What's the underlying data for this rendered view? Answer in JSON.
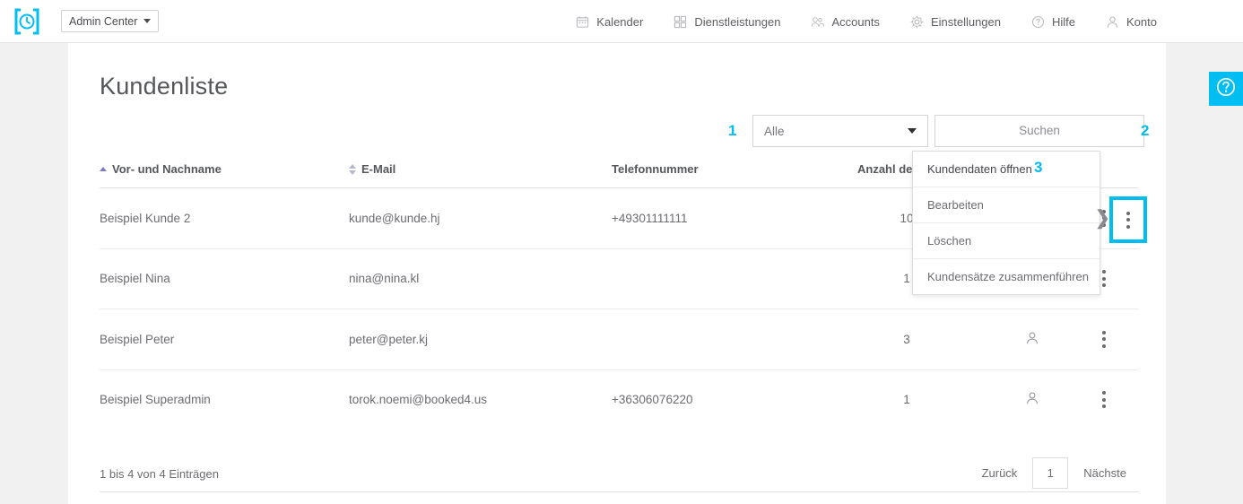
{
  "topbar": {
    "logo_icon": "clock-bracket-logo",
    "brand": {
      "label": "Admin Center",
      "caret_icon": "chevron-down-icon"
    },
    "nav": [
      {
        "label": "Kalender",
        "icon": "calendar-icon"
      },
      {
        "label": "Dienstleistungen",
        "icon": "grid-squares-icon"
      },
      {
        "label": "Accounts",
        "icon": "people-icon"
      },
      {
        "label": "Einstellungen",
        "icon": "gear-icon"
      },
      {
        "label": "Hilfe",
        "icon": "question-circle-icon"
      },
      {
        "label": "Konto",
        "icon": "person-icon"
      }
    ]
  },
  "page": {
    "title": "Kundenliste"
  },
  "filters": {
    "select_value": "Alle",
    "select_caret_icon": "caret-down-icon",
    "search_placeholder": "Suchen",
    "annotation_1": "1",
    "annotation_2": "2"
  },
  "table": {
    "headers": [
      {
        "label": "Vor- und Nachname",
        "sort": "asc",
        "sort_icon": "sort-ascending-icon"
      },
      {
        "label": "E-Mail",
        "sort": "none",
        "sort_icon": "sort-both-icon"
      },
      {
        "label": "Telefonnummer",
        "sort": "none",
        "sort_icon": ""
      },
      {
        "label": "Anzahl der",
        "sort": "none",
        "sort_icon": ""
      }
    ],
    "rows": [
      {
        "name": "Beispiel Kunde 2",
        "email": "kunde@kunde.hj",
        "phone": "+49301111111",
        "count": "10",
        "user_icon": "",
        "menu_icon": "kebab-menu-icon"
      },
      {
        "name": "Beispiel Nina",
        "email": "nina@nina.kl",
        "phone": "",
        "count": "1",
        "user_icon": "",
        "menu_icon": "kebab-menu-icon"
      },
      {
        "name": "Beispiel Peter",
        "email": "peter@peter.kj",
        "phone": "",
        "count": "3",
        "user_icon": "person-icon",
        "menu_icon": "kebab-menu-icon"
      },
      {
        "name": "Beispiel Superadmin",
        "email": "torok.noemi@booked4.us",
        "phone": "+36306076220",
        "count": "1",
        "user_icon": "person-icon",
        "menu_icon": "kebab-menu-icon"
      }
    ]
  },
  "context_menu": {
    "annotation_3": "3",
    "items": [
      {
        "label": "Kundendaten öffnen"
      },
      {
        "label": "Bearbeiten"
      },
      {
        "label": "Löschen"
      },
      {
        "label": "Kundensätze zusammenführen"
      }
    ]
  },
  "footer": {
    "info": "1 bis 4 von 4 Einträgen",
    "prev_label": "Zurück",
    "page_number": "1",
    "next_label": "Nächste"
  },
  "help_tab": {
    "icon": "question-circle-icon"
  },
  "colors": {
    "accent": "#00bdf2",
    "page_bg": "#f1f1f1",
    "text": "#5d5d62"
  }
}
